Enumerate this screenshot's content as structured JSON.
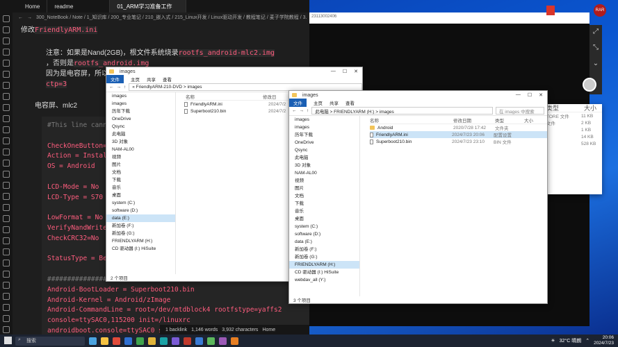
{
  "obsidian": {
    "tabs": [
      "Home",
      "readme",
      "01_ARM学习准备工作"
    ],
    "breadcrumb": "300_NoteBook / Note / 1_知识库 / 200_专业笔记 / 210_嵌入式 / 215_Linux开发 / Linux驱动开发 / 教程笔记 / 麦子学院教程 / 3.",
    "line1_text": "修改",
    "line1_code": "FriendlyARM.ini",
    "note_prefix": "注意：如果是Nand(2GB)，根文件系统烧录",
    "note_code1": "rootfs_android-mlc2.img",
    "note_mid": "，否则是",
    "note_code2": "rootfs_android.img",
    "note_line3": "因为是电容屏，所以",
    "note_code3": "ctp=3",
    "section": "电容屏、mlc2",
    "code_lines": [
      {
        "k": "#This line cann",
        "v": "",
        "comment": true
      },
      {
        "k": "",
        "v": ""
      },
      {
        "k": "CheckOneButton=",
        "v": ""
      },
      {
        "k": "Action = Instal",
        "v": ""
      },
      {
        "k": "OS = Android",
        "v": ""
      },
      {
        "k": "",
        "v": ""
      },
      {
        "k": "LCD-Mode = No",
        "v": ""
      },
      {
        "k": "LCD-Type = S70",
        "v": ""
      },
      {
        "k": "",
        "v": ""
      },
      {
        "k": "LowFormat = No",
        "v": ""
      },
      {
        "k": "VerifyNandWrite",
        "v": ""
      },
      {
        "k": "CheckCRC32=No",
        "v": ""
      },
      {
        "k": "",
        "v": ""
      },
      {
        "k": "StatusType = Be",
        "v": ""
      },
      {
        "k": "",
        "v": ""
      },
      {
        "k": "################## Android 4.0.3 ######################",
        "v": "",
        "comment": true
      },
      {
        "k": "Android-BootLoader = Superboot210.bin",
        "v": ""
      },
      {
        "k": "Android-Kernel = Android/zImage",
        "v": ""
      },
      {
        "k": "Android-CommandLine = root=/dev/mtdblock4 rootfstype=yaffs2",
        "v": ""
      },
      {
        "k": "console=ttySAC0,115200 init=/linuxrc",
        "v": ""
      },
      {
        "k": "androidboot.console=ttySAC0 skip",
        "v": ""
      }
    ],
    "status": [
      "1 backlink",
      "1,146 words",
      "3,932 characters",
      "Home"
    ]
  },
  "right_panel": {
    "top_text": "23113002406",
    "side_icons": [
      "⤢",
      "⤡",
      "⌄"
    ]
  },
  "explorer1": {
    "title": "images",
    "tabs": [
      "文件",
      "主页",
      "共享",
      "查看"
    ],
    "address": "« FriendlyARM-210-DVD  >  images",
    "nav": [
      "images",
      "images",
      "历年下载",
      "OneDrive",
      "Qsync",
      "此电脑",
      "3D 对象",
      "NAM-AL00",
      "视频",
      "图片",
      "文档",
      "下载",
      "音乐",
      "桌面",
      "system (C:)",
      "software (D:)",
      "data (E:)",
      "新加卷 (F:)",
      "新加卷 (G:)",
      "FRIENDLYARM (H:)",
      "CD 驱动器 (I:) HiSuite"
    ],
    "nav_selected": 16,
    "headers": [
      "名称",
      "修改日"
    ],
    "files": [
      {
        "name": "FriendlyARM.ini",
        "date": "2024/7/2",
        "type": "doc"
      },
      {
        "name": "Superboot210.bin",
        "date": "2024/7/2",
        "type": "doc"
      }
    ],
    "status": "2 个项目"
  },
  "explorer2": {
    "title": "images",
    "tabs": [
      "文件",
      "主页",
      "共享",
      "查看"
    ],
    "address": "此电脑 > FRIENDLYARM (H:) > images",
    "search_placeholder": "在 images 中搜索",
    "nav": [
      "images",
      "images",
      "历年下载",
      "OneDrive",
      "Qsync",
      "此电脑",
      "3D 对象",
      "NAM-AL00",
      "视频",
      "图片",
      "文档",
      "下载",
      "音乐",
      "桌面",
      "system (C:)",
      "software (D:)",
      "data (E:)",
      "新加卷 (F:)",
      "新加卷 (G:)",
      "FRIENDLYARM (H:)",
      "CD 驱动器 (I:) HiSuite",
      "webdav_all (Y:)"
    ],
    "nav_selected": 19,
    "headers": [
      "名称",
      "修改日期",
      "类型",
      "大小"
    ],
    "files": [
      {
        "name": "Android",
        "date": "2020/7/28 17:42",
        "kind": "文件夹",
        "size": "",
        "type": "folder"
      },
      {
        "name": "FriendlyARM.ini",
        "date": "2024/7/23 20:06",
        "kind": "配置设置",
        "size": "",
        "type": "doc"
      },
      {
        "name": "Superboot210.bin",
        "date": "2024/7/23 23:10",
        "kind": "BIN 文件",
        "size": "",
        "type": "doc"
      }
    ],
    "selected_file": 1,
    "status": "3 个项目"
  },
  "bg_explorer": {
    "headers": [
      "类型",
      "大小"
    ],
    "rows": [
      [
        "TORE 文件",
        "11 KB"
      ],
      [
        "文件",
        "2 KB"
      ],
      [
        "",
        "1 KB"
      ],
      [
        "",
        "14 KB"
      ],
      [
        "",
        "528 KB"
      ]
    ]
  },
  "taskbar": {
    "search": "搜索",
    "weather": "32°C 晴朗",
    "time": "20:06",
    "date": "2024/7/23"
  },
  "colors": {
    "accent": "#1a5fb4",
    "obs_bg": "#1e1e1e",
    "code_key": "#ff5d7e",
    "selection": "#cce4f7"
  }
}
